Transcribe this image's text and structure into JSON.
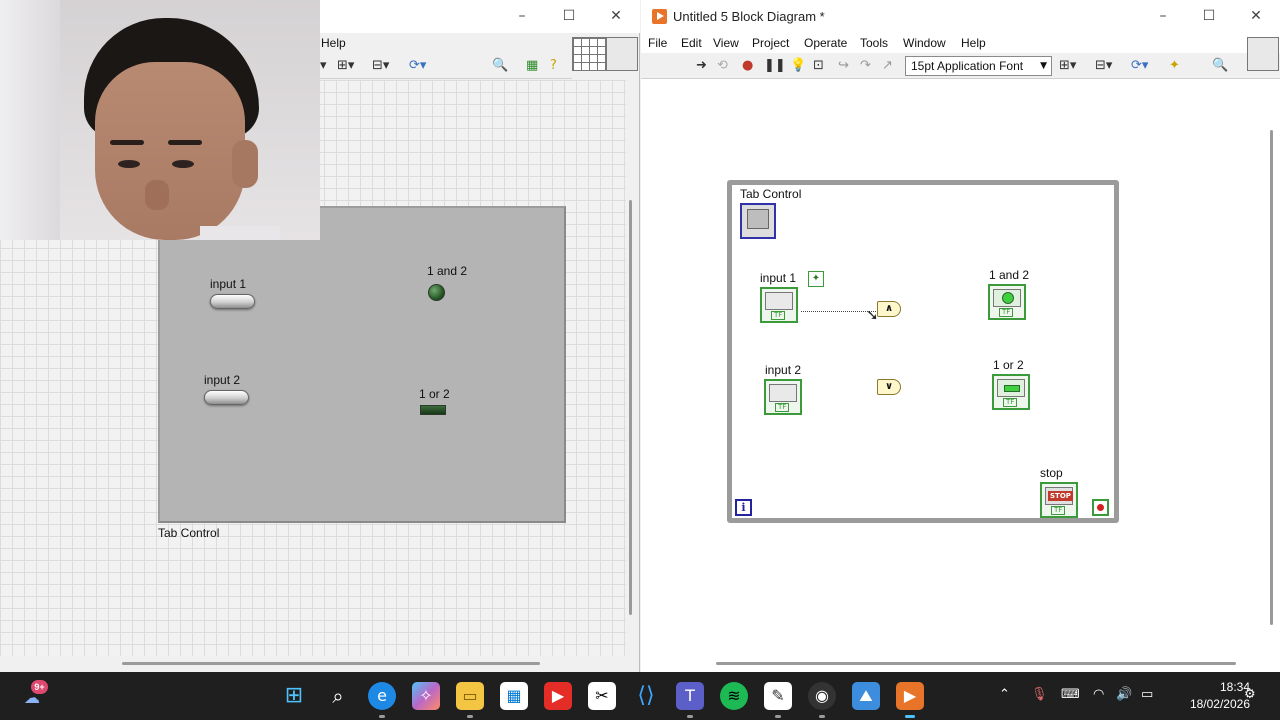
{
  "front_panel": {
    "menu_help": "Help",
    "tab_control_caption": "Tab Control",
    "controls": {
      "input1_label": "input 1",
      "input2_label": "input 2",
      "led1_label": "1 and 2",
      "led2_label": "1 or 2"
    }
  },
  "block_diagram": {
    "title": "Untitled 5 Block Diagram *",
    "menu": [
      "File",
      "Edit",
      "View",
      "Project",
      "Operate",
      "Tools",
      "Window",
      "Help"
    ],
    "font_selector": "15pt Application Font",
    "labels": {
      "tab_control": "Tab Control",
      "input1": "input 1",
      "input2": "input 2",
      "and_out": "1 and 2",
      "or_out": "1 or 2",
      "stop": "stop",
      "stop_btn_text": "STOP",
      "tf": "TF",
      "iteration": "i",
      "and_gate": "∧",
      "or_gate": "∨"
    }
  },
  "taskbar": {
    "badge": "9+",
    "time": "18:34",
    "date": "18/02/2026"
  },
  "colors": {
    "loop_border": "#9b9b9b",
    "terminal_green": "#3b9b3b",
    "taskbar": "#1f1f1f",
    "labview_orange": "#e8742a"
  }
}
